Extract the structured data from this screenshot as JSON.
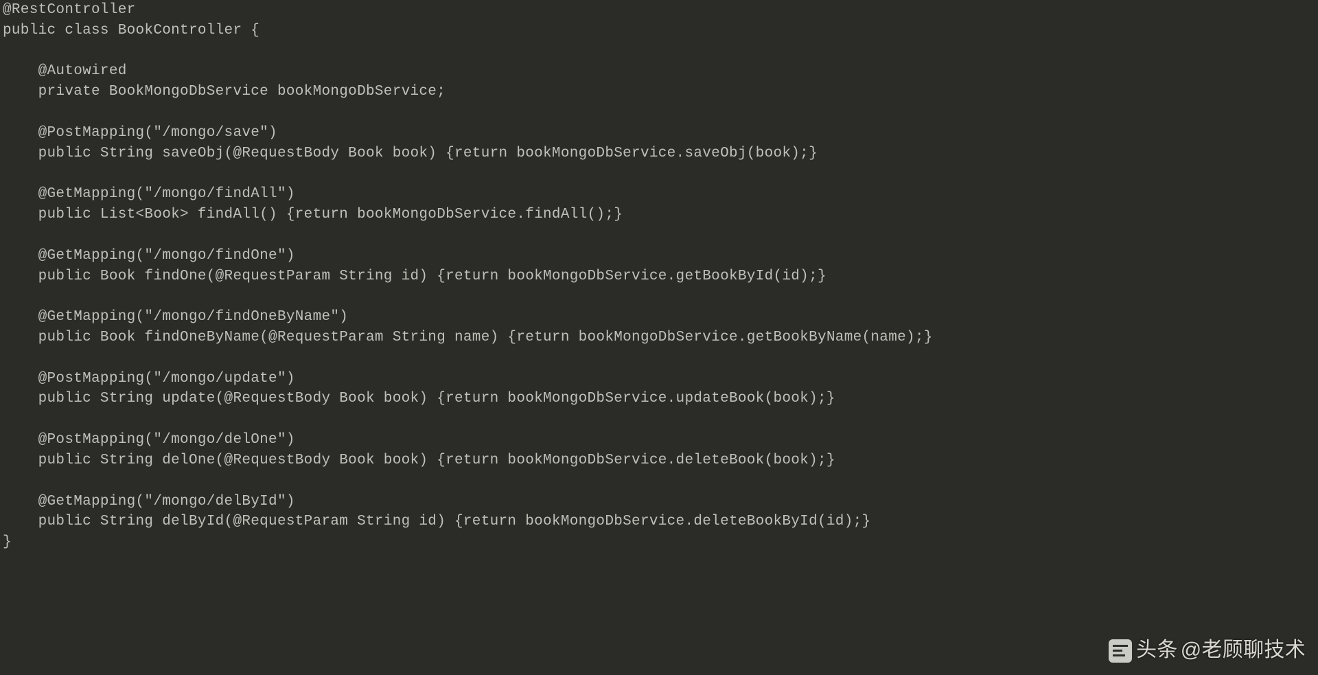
{
  "code": {
    "line1": "@RestController",
    "line2": "public class BookController {",
    "line3": "",
    "line4": "    @Autowired",
    "line5": "    private BookMongoDbService bookMongoDbService;",
    "line6": "",
    "line7": "    @PostMapping(\"/mongo/save\")",
    "line8": "    public String saveObj(@RequestBody Book book) {return bookMongoDbService.saveObj(book);}",
    "line9": "",
    "line10": "    @GetMapping(\"/mongo/findAll\")",
    "line11": "    public List<Book> findAll() {return bookMongoDbService.findAll();}",
    "line12": "",
    "line13": "    @GetMapping(\"/mongo/findOne\")",
    "line14": "    public Book findOne(@RequestParam String id) {return bookMongoDbService.getBookById(id);}",
    "line15": "",
    "line16": "    @GetMapping(\"/mongo/findOneByName\")",
    "line17": "    public Book findOneByName(@RequestParam String name) {return bookMongoDbService.getBookByName(name);}",
    "line18": "",
    "line19": "    @PostMapping(\"/mongo/update\")",
    "line20": "    public String update(@RequestBody Book book) {return bookMongoDbService.updateBook(book);}",
    "line21": "",
    "line22": "    @PostMapping(\"/mongo/delOne\")",
    "line23": "    public String delOne(@RequestBody Book book) {return bookMongoDbService.deleteBook(book);}",
    "line24": "",
    "line25": "    @GetMapping(\"/mongo/delById\")",
    "line26": "    public String delById(@RequestParam String id) {return bookMongoDbService.deleteBookById(id);}",
    "line27": "}"
  },
  "watermark": {
    "prefix": "头条",
    "handle": "@老顾聊技术"
  }
}
